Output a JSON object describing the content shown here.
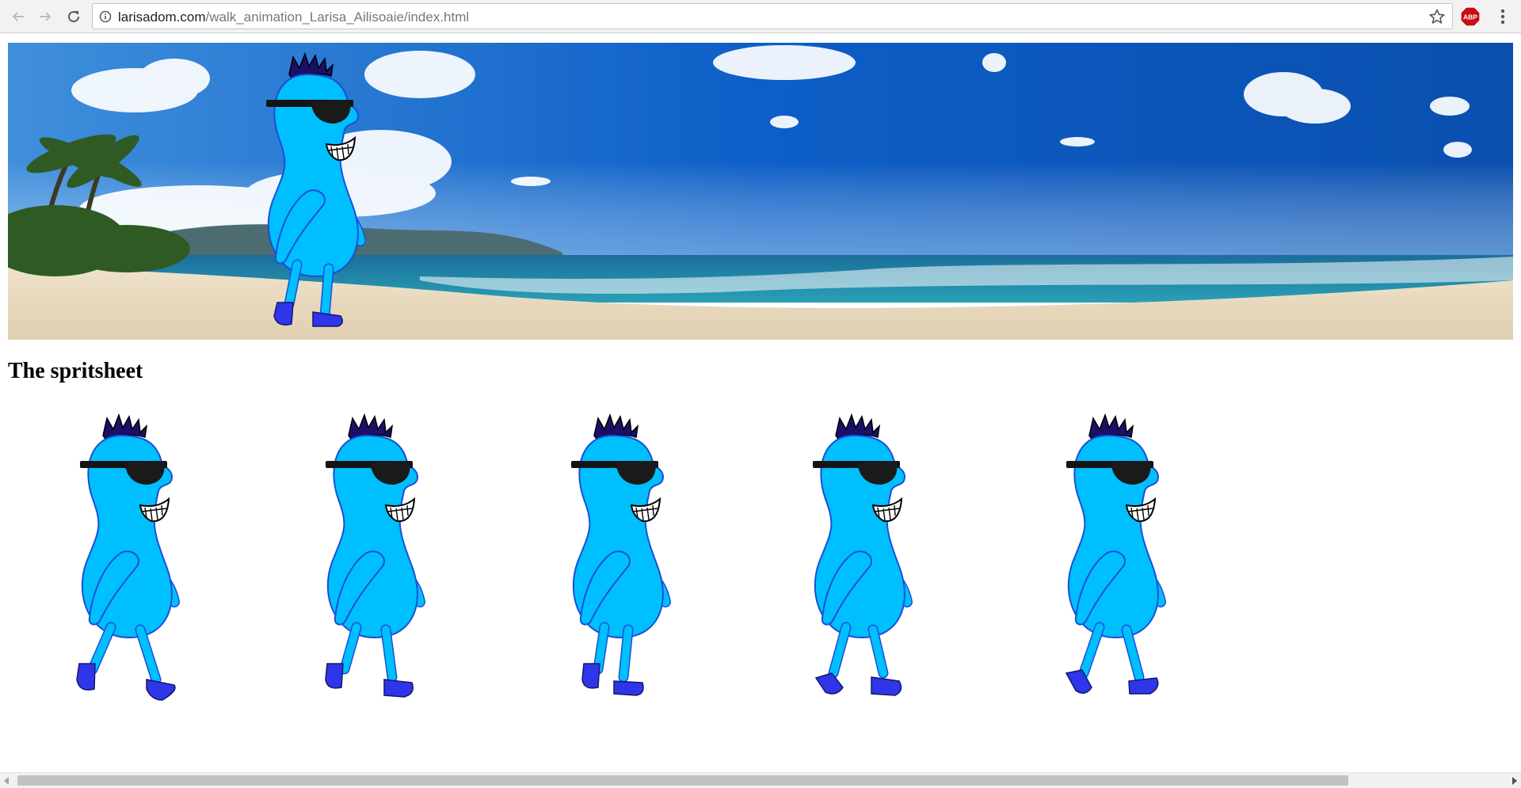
{
  "browser": {
    "url_host": "larisadom.com",
    "url_path": "/walk_animation_Larisa_Ailisoaie/index.html",
    "back_icon": "arrow-left-icon",
    "forward_icon": "arrow-right-icon",
    "reload_icon": "reload-icon",
    "info_icon": "info-icon",
    "bookmark_icon": "star-icon",
    "extension_label": "ABP",
    "menu_icon": "kebab-menu-icon"
  },
  "page": {
    "heading": "The spritsheet",
    "banner_image": "beach-panorama-with-walking-character",
    "sprite_frame_count": 5
  },
  "colors": {
    "character_body": "#00bfff",
    "character_outline": "#1a4fd6",
    "character_shoes": "#2f35e8",
    "character_hair": "#1a1068",
    "sky": "#1d6fd0",
    "sea": "#1e7aa0",
    "sand": "#e8d8bd",
    "abp_red": "#c70d10"
  }
}
